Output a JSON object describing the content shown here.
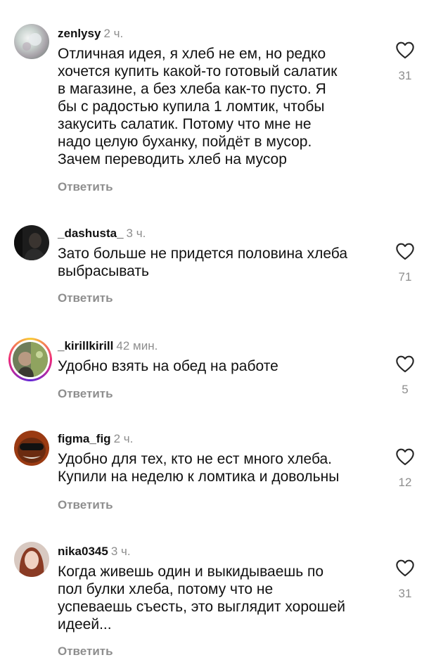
{
  "comments": [
    {
      "username": "zenlysy",
      "time": "2 ч.",
      "text": "Отличная идея, я хлеб не ем, но редко\nхочется купить какой-то готовый салатик\nв магазине, а без хлеба как-то пусто. Я\nбы с радостью купила 1 ломтик, чтобы\nзакусить салатик. Потому что мне не\nнадо целую буханку, пойдёт в мусор.\nЗачем переводить хлеб на мусор",
      "reply": "Ответить",
      "likes": "31"
    },
    {
      "username": "_dashusta_",
      "time": "3 ч.",
      "text": "Зато больше не придется половина хлеба\nвыбрасывать",
      "reply": "Ответить",
      "likes": "71"
    },
    {
      "username": "_kirillkirill",
      "time": "42 мин.",
      "text": "Удобно взять на обед на работе",
      "reply": "Ответить",
      "likes": "5"
    },
    {
      "username": "figma_fig",
      "time": "2 ч.",
      "text": "Удобно для тех, кто не ест много хлеба.\nКупили на неделю к ломтика и довольны",
      "reply": "Ответить",
      "likes": "12"
    },
    {
      "username": "nika0345",
      "time": "3 ч.",
      "text": "Когда живешь один и выкидываешь по\nпол булки хлеба, потому что не\nуспеваешь съесть, это выглядит хорошей\nидеей...",
      "reply": "Ответить",
      "likes": "31"
    }
  ],
  "icons": {
    "like": "heart-outline-icon"
  },
  "colors": {
    "text": "#111111",
    "secondary": "#8e8e8e",
    "background": "#ffffff"
  }
}
